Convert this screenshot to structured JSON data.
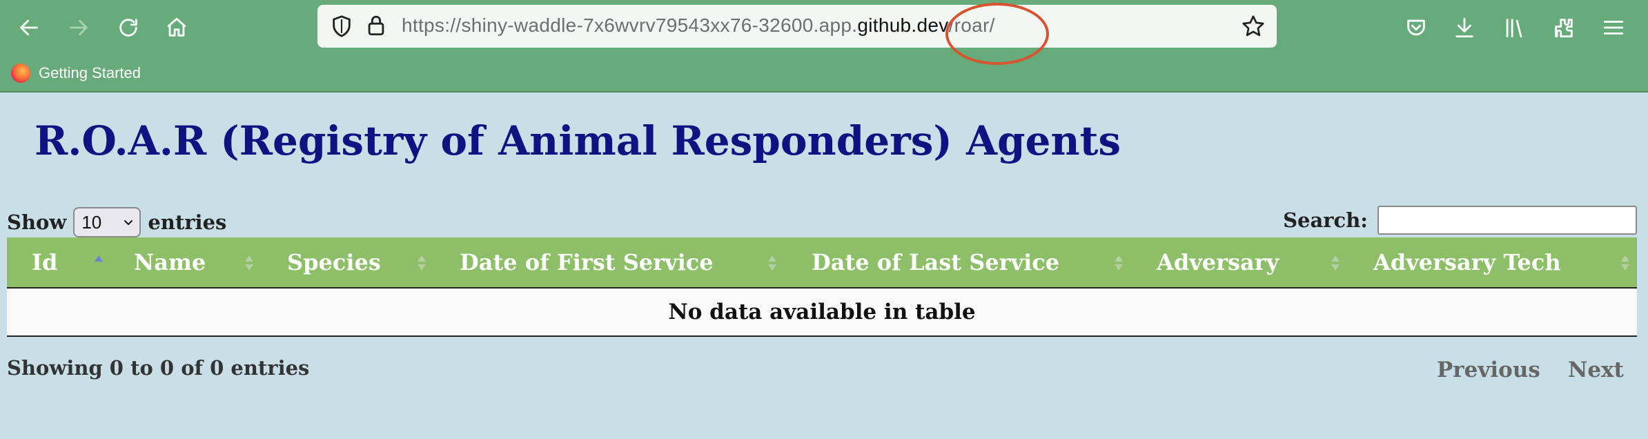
{
  "browser": {
    "url_prefix": "https://shiny-waddle-7x6wvrv79543xx76-32600.app.",
    "url_host": "github.dev",
    "url_path": "/roar/",
    "bookmark_label": "Getting Started",
    "icons": [
      "back-icon",
      "forward-icon",
      "reload-icon",
      "home-icon",
      "shield-icon",
      "lock-icon",
      "star-icon",
      "pocket-icon",
      "download-icon",
      "library-icon",
      "extensions-icon",
      "menu-icon"
    ]
  },
  "page": {
    "title": "R.O.A.R (Registry of Animal Responders) Agents"
  },
  "controls": {
    "show_label": "Show",
    "entries_label": "entries",
    "page_length_value": "10",
    "search_label": "Search:",
    "search_value": ""
  },
  "table": {
    "columns": [
      "Id",
      "Name",
      "Species",
      "Date of First Service",
      "Date of Last Service",
      "Adversary",
      "Adversary Tech"
    ],
    "sorted_column": "Id",
    "sort_direction": "ascending",
    "empty_message": "No data available in table"
  },
  "footer": {
    "info": "Showing 0 to 0 of 0 entries",
    "previous_label": "Previous",
    "next_label": "Next"
  },
  "colors": {
    "toolbar": "#67ab7b",
    "page_background": "#c9dfe7",
    "title": "#0c1482",
    "table_header": "#8cbf67",
    "annotation": "#d9532f"
  }
}
